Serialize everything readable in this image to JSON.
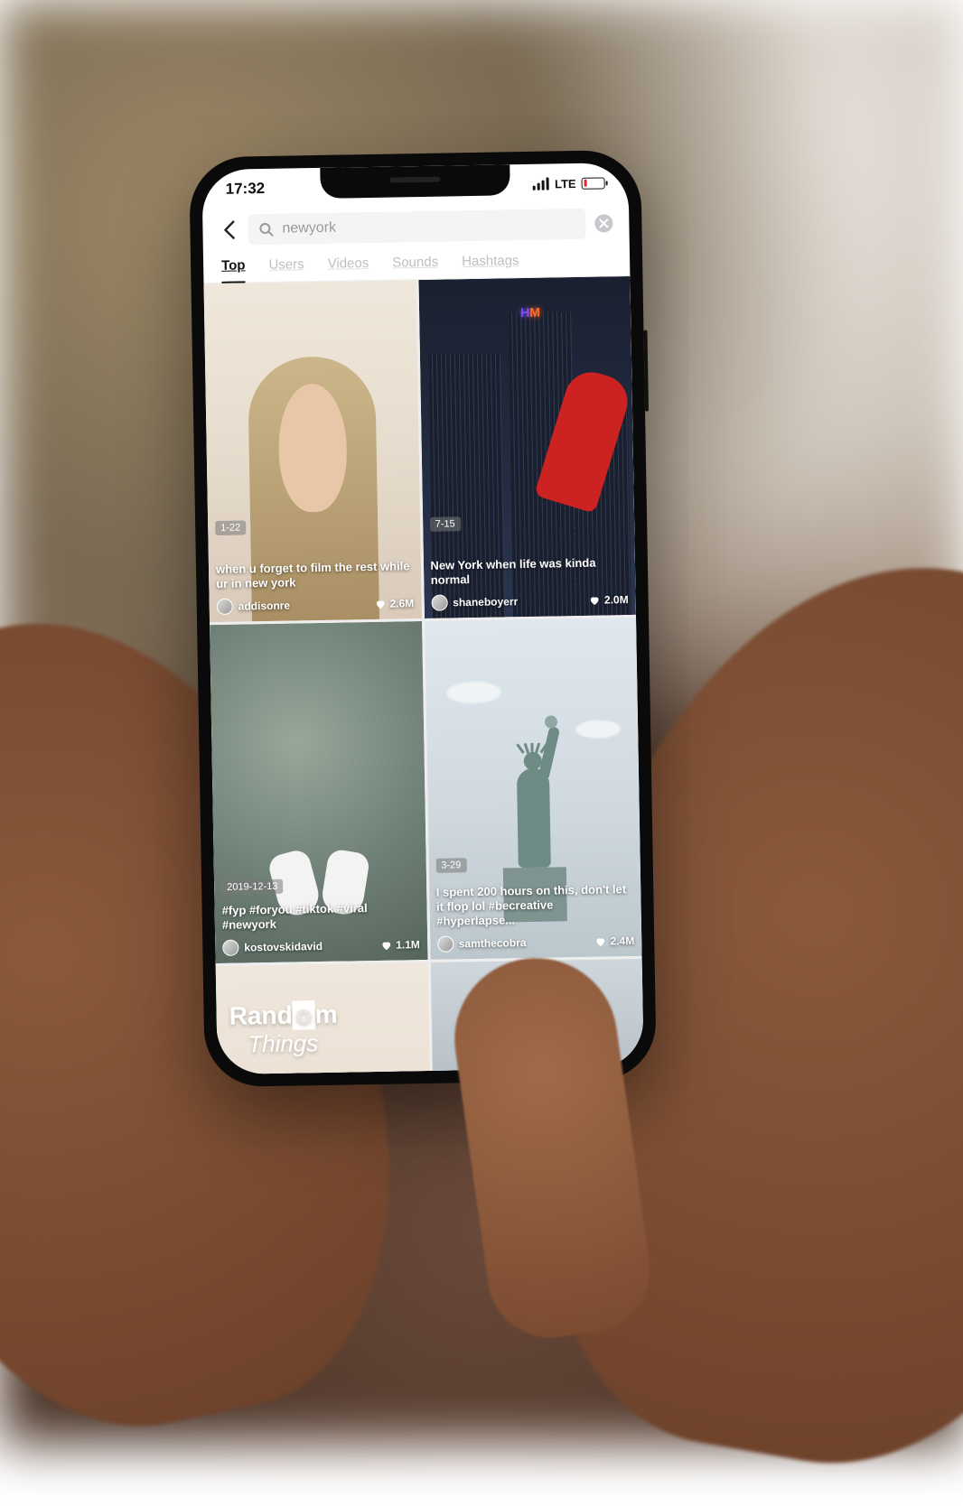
{
  "status": {
    "time": "17:32",
    "network": "LTE"
  },
  "search": {
    "query": "newyork"
  },
  "tabs": [
    {
      "label": "Top",
      "active": true
    },
    {
      "label": "Users",
      "active": false
    },
    {
      "label": "Videos",
      "active": false
    },
    {
      "label": "Sounds",
      "active": false
    },
    {
      "label": "Hashtags",
      "active": false
    }
  ],
  "results": [
    {
      "date_badge": "1-22",
      "caption": "when u forget to film the rest while ur in new york",
      "username": "addisonre",
      "likes": "2.6M"
    },
    {
      "date_badge": "7-15",
      "caption": "New York when life was kinda normal",
      "username": "shaneboyerr",
      "likes": "2.0M"
    },
    {
      "date_badge": "2019-12-13",
      "caption": "#fyp #foryou #tiktok #viral #newyork",
      "username": "kostovskidavid",
      "likes": "1.1M"
    },
    {
      "date_badge": "3-29",
      "caption": "I spent 200 hours on this, don't let it flop lol #becreative #hyperlapse...",
      "username": "samthecobra",
      "likes": "2.4M"
    },
    {
      "overlay_line1": "Random",
      "overlay_line2": "Things"
    },
    {}
  ]
}
